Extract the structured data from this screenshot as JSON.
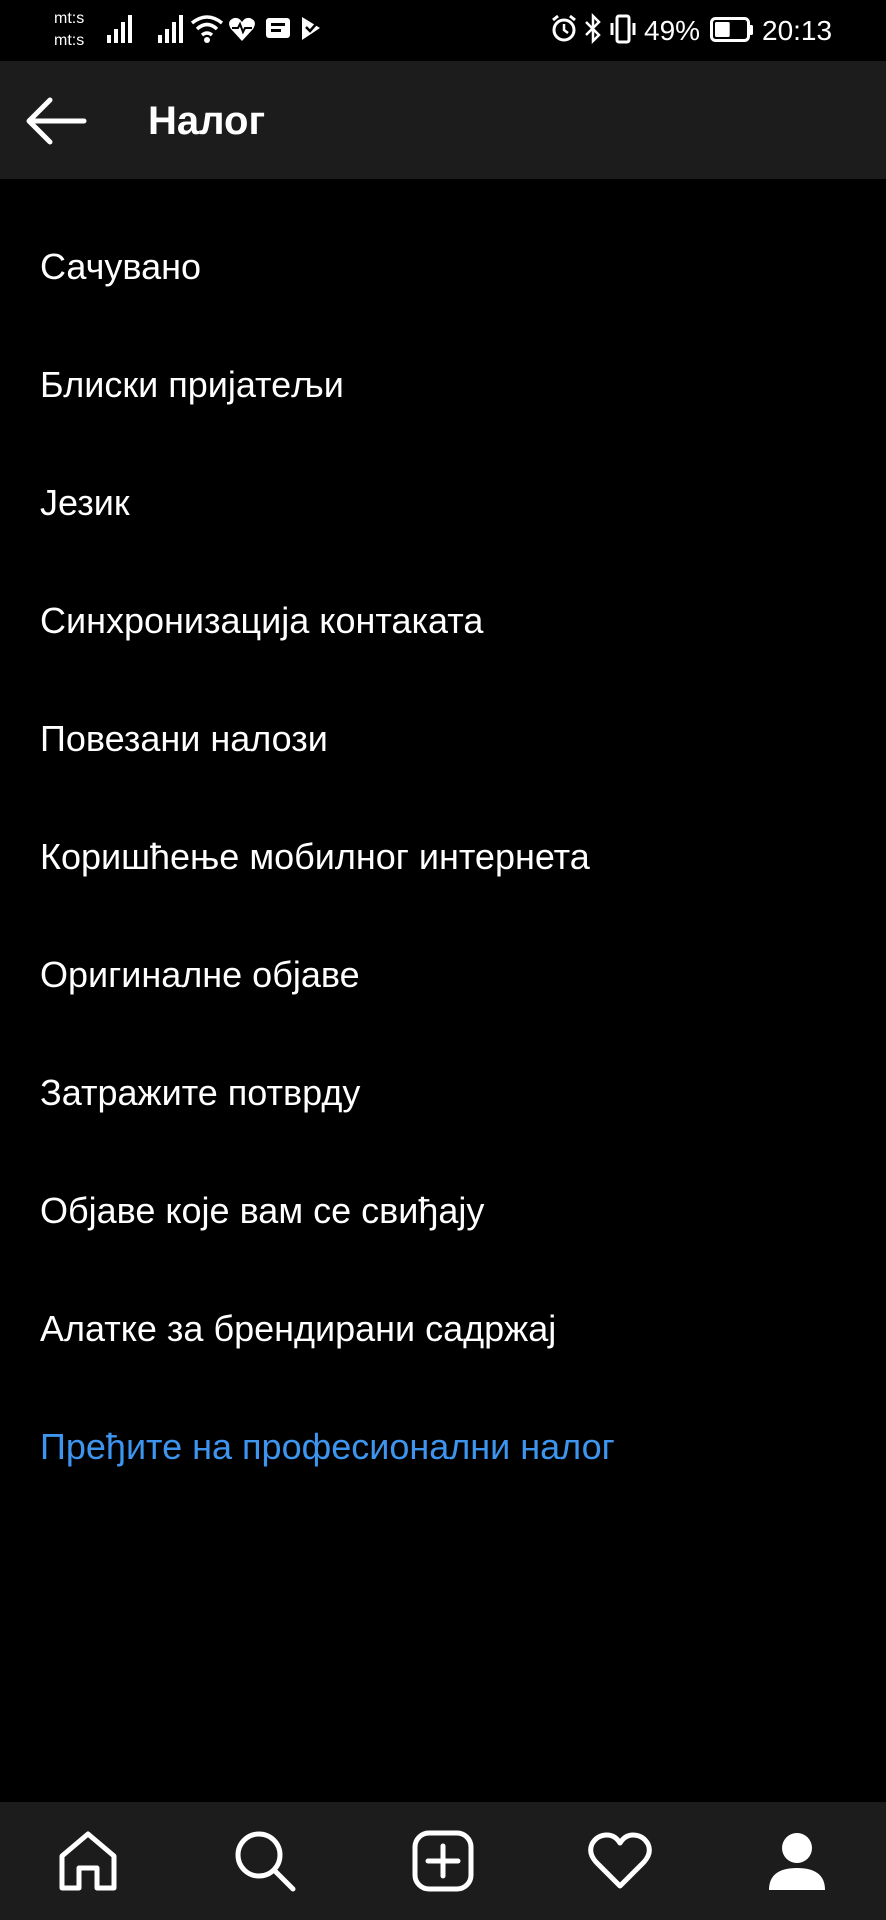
{
  "status_bar": {
    "carrier_1": "mt:s",
    "carrier_2": "mt:s",
    "battery_percent": "49%",
    "time": "20:13",
    "icons": [
      "signal-icon",
      "signal-icon",
      "wifi-icon",
      "health-icon",
      "message-icon",
      "play-icon",
      "alarm-icon",
      "bluetooth-icon",
      "vibrate-icon",
      "battery-icon"
    ],
    "battery_level": 0.49
  },
  "header": {
    "title": "Налог",
    "back_icon": "arrow-left-icon"
  },
  "menu": {
    "items": [
      {
        "label": "Сачувано"
      },
      {
        "label": "Блиски пријатељи"
      },
      {
        "label": "Језик"
      },
      {
        "label": "Синхронизација контаката"
      },
      {
        "label": "Повезани налози"
      },
      {
        "label": "Коришћење мобилног интернета"
      },
      {
        "label": "Оригиналне објаве"
      },
      {
        "label": "Затражите потврду"
      },
      {
        "label": "Објаве које вам се свиђају"
      },
      {
        "label": "Алатке за брендирани садржај"
      },
      {
        "label": "Пређите на професионални налог"
      }
    ]
  },
  "bottom_nav": {
    "items": [
      "home-icon",
      "search-icon",
      "add-post-icon",
      "heart-icon",
      "profile-icon"
    ]
  },
  "colors": {
    "background": "#000000",
    "bar": "#1c1c1c",
    "text": "#ffffff",
    "accent": "#3d95ef"
  }
}
